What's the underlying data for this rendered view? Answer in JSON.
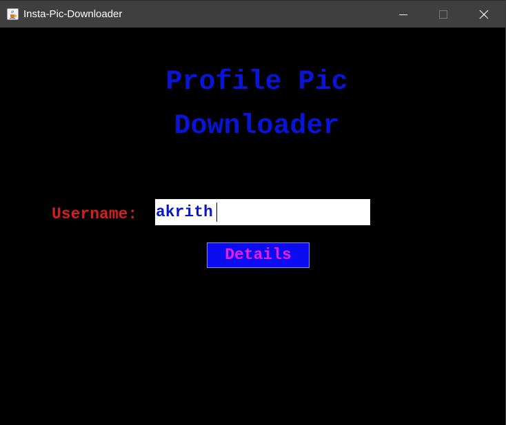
{
  "window": {
    "title": "Insta-Pic-Downloader",
    "app_icon": "java-cup-icon",
    "controls": {
      "minimize_icon": "minimize-icon",
      "maximize_icon": "maximize-icon",
      "close_icon": "close-icon"
    }
  },
  "main": {
    "heading_line1": "Profile Pic",
    "heading_line2": "Downloader",
    "username_label": "Username:",
    "username_value": "akrith",
    "details_button": "Details"
  },
  "colors": {
    "background": "#000000",
    "titlebar": "#3f3f3f",
    "heading": "#0a14d8",
    "label": "#d21f1f",
    "input_text": "#0a14c8",
    "button_bg": "#0c0cf0",
    "button_text": "#e81ee8"
  }
}
